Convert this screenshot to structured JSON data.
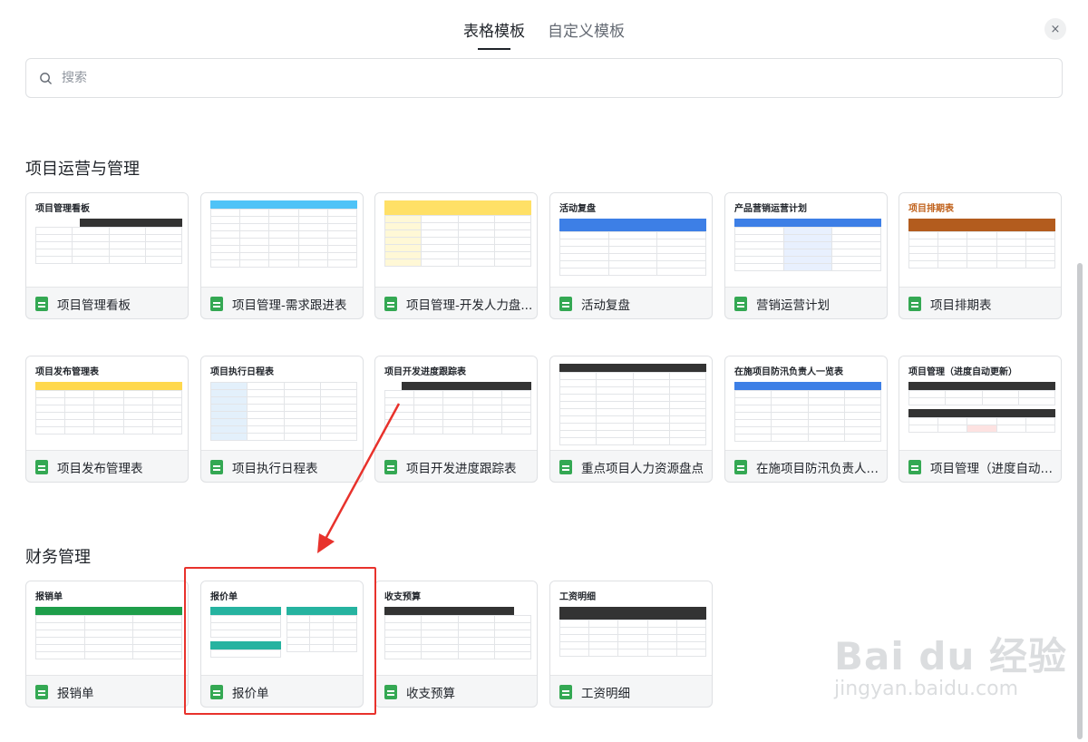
{
  "tabs": [
    {
      "label": "表格模板",
      "active": true
    },
    {
      "label": "自定义模板",
      "active": false
    }
  ],
  "close_icon": "×",
  "search": {
    "placeholder": "搜索",
    "value": ""
  },
  "sections": {
    "project": {
      "title": "项目运营与管理",
      "cards": [
        {
          "label": "项目管理看板",
          "thumb_title": "项目管理看板"
        },
        {
          "label": "项目管理-需求跟进表",
          "thumb_title": ""
        },
        {
          "label": "项目管理-开发人力盘...",
          "thumb_title": ""
        },
        {
          "label": "活动复盘",
          "thumb_title": "活动复盘"
        },
        {
          "label": "营销运营计划",
          "thumb_title": "产品营销运营计划"
        },
        {
          "label": "项目排期表",
          "thumb_title": "项目排期表"
        },
        {
          "label": "项目发布管理表",
          "thumb_title": "项目发布管理表"
        },
        {
          "label": "项目执行日程表",
          "thumb_title": "项目执行日程表"
        },
        {
          "label": "项目开发进度跟踪表",
          "thumb_title": "项目开发进度跟踪表"
        },
        {
          "label": "重点项目人力资源盘点",
          "thumb_title": ""
        },
        {
          "label": "在施项目防汛负责人一...",
          "thumb_title": "在施项目防汛负责人一览表"
        },
        {
          "label": "项目管理（进度自动更...",
          "thumb_title": "项目管理（进度自动更新）"
        }
      ]
    },
    "finance": {
      "title": "财务管理",
      "cards": [
        {
          "label": "报销单",
          "thumb_title": "报销单"
        },
        {
          "label": "报价单",
          "thumb_title": "报价单"
        },
        {
          "label": "收支预算",
          "thumb_title": "收支预算"
        },
        {
          "label": "工资明细",
          "thumb_title": "工资明细"
        }
      ]
    }
  },
  "watermark": {
    "main": "Bai du 经验",
    "sub": "jingyan.baidu.com"
  },
  "colors": {
    "accent_red": "#e8322c",
    "sheet_green": "#34a853"
  }
}
